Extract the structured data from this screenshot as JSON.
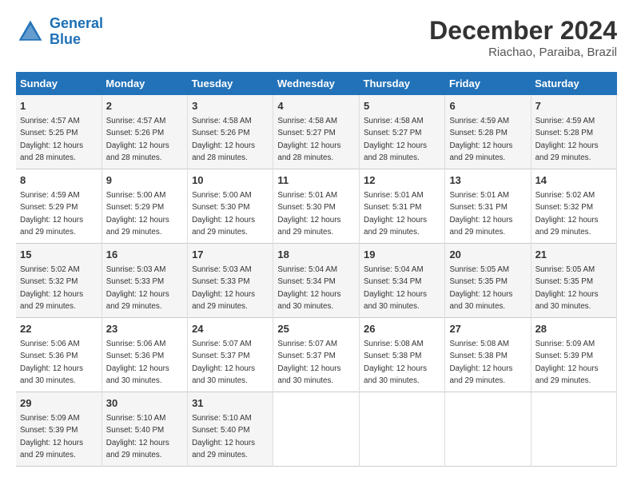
{
  "header": {
    "logo_line1": "General",
    "logo_line2": "Blue",
    "month_year": "December 2024",
    "location": "Riachao, Paraiba, Brazil"
  },
  "weekdays": [
    "Sunday",
    "Monday",
    "Tuesday",
    "Wednesday",
    "Thursday",
    "Friday",
    "Saturday"
  ],
  "weeks": [
    [
      {
        "day": "1",
        "sunrise": "4:57 AM",
        "sunset": "5:25 PM",
        "daylight": "12 hours and 28 minutes."
      },
      {
        "day": "2",
        "sunrise": "4:57 AM",
        "sunset": "5:26 PM",
        "daylight": "12 hours and 28 minutes."
      },
      {
        "day": "3",
        "sunrise": "4:58 AM",
        "sunset": "5:26 PM",
        "daylight": "12 hours and 28 minutes."
      },
      {
        "day": "4",
        "sunrise": "4:58 AM",
        "sunset": "5:27 PM",
        "daylight": "12 hours and 28 minutes."
      },
      {
        "day": "5",
        "sunrise": "4:58 AM",
        "sunset": "5:27 PM",
        "daylight": "12 hours and 28 minutes."
      },
      {
        "day": "6",
        "sunrise": "4:59 AM",
        "sunset": "5:28 PM",
        "daylight": "12 hours and 29 minutes."
      },
      {
        "day": "7",
        "sunrise": "4:59 AM",
        "sunset": "5:28 PM",
        "daylight": "12 hours and 29 minutes."
      }
    ],
    [
      {
        "day": "8",
        "sunrise": "4:59 AM",
        "sunset": "5:29 PM",
        "daylight": "12 hours and 29 minutes."
      },
      {
        "day": "9",
        "sunrise": "5:00 AM",
        "sunset": "5:29 PM",
        "daylight": "12 hours and 29 minutes."
      },
      {
        "day": "10",
        "sunrise": "5:00 AM",
        "sunset": "5:30 PM",
        "daylight": "12 hours and 29 minutes."
      },
      {
        "day": "11",
        "sunrise": "5:01 AM",
        "sunset": "5:30 PM",
        "daylight": "12 hours and 29 minutes."
      },
      {
        "day": "12",
        "sunrise": "5:01 AM",
        "sunset": "5:31 PM",
        "daylight": "12 hours and 29 minutes."
      },
      {
        "day": "13",
        "sunrise": "5:01 AM",
        "sunset": "5:31 PM",
        "daylight": "12 hours and 29 minutes."
      },
      {
        "day": "14",
        "sunrise": "5:02 AM",
        "sunset": "5:32 PM",
        "daylight": "12 hours and 29 minutes."
      }
    ],
    [
      {
        "day": "15",
        "sunrise": "5:02 AM",
        "sunset": "5:32 PM",
        "daylight": "12 hours and 29 minutes."
      },
      {
        "day": "16",
        "sunrise": "5:03 AM",
        "sunset": "5:33 PM",
        "daylight": "12 hours and 29 minutes."
      },
      {
        "day": "17",
        "sunrise": "5:03 AM",
        "sunset": "5:33 PM",
        "daylight": "12 hours and 29 minutes."
      },
      {
        "day": "18",
        "sunrise": "5:04 AM",
        "sunset": "5:34 PM",
        "daylight": "12 hours and 30 minutes."
      },
      {
        "day": "19",
        "sunrise": "5:04 AM",
        "sunset": "5:34 PM",
        "daylight": "12 hours and 30 minutes."
      },
      {
        "day": "20",
        "sunrise": "5:05 AM",
        "sunset": "5:35 PM",
        "daylight": "12 hours and 30 minutes."
      },
      {
        "day": "21",
        "sunrise": "5:05 AM",
        "sunset": "5:35 PM",
        "daylight": "12 hours and 30 minutes."
      }
    ],
    [
      {
        "day": "22",
        "sunrise": "5:06 AM",
        "sunset": "5:36 PM",
        "daylight": "12 hours and 30 minutes."
      },
      {
        "day": "23",
        "sunrise": "5:06 AM",
        "sunset": "5:36 PM",
        "daylight": "12 hours and 30 minutes."
      },
      {
        "day": "24",
        "sunrise": "5:07 AM",
        "sunset": "5:37 PM",
        "daylight": "12 hours and 30 minutes."
      },
      {
        "day": "25",
        "sunrise": "5:07 AM",
        "sunset": "5:37 PM",
        "daylight": "12 hours and 30 minutes."
      },
      {
        "day": "26",
        "sunrise": "5:08 AM",
        "sunset": "5:38 PM",
        "daylight": "12 hours and 30 minutes."
      },
      {
        "day": "27",
        "sunrise": "5:08 AM",
        "sunset": "5:38 PM",
        "daylight": "12 hours and 29 minutes."
      },
      {
        "day": "28",
        "sunrise": "5:09 AM",
        "sunset": "5:39 PM",
        "daylight": "12 hours and 29 minutes."
      }
    ],
    [
      {
        "day": "29",
        "sunrise": "5:09 AM",
        "sunset": "5:39 PM",
        "daylight": "12 hours and 29 minutes."
      },
      {
        "day": "30",
        "sunrise": "5:10 AM",
        "sunset": "5:40 PM",
        "daylight": "12 hours and 29 minutes."
      },
      {
        "day": "31",
        "sunrise": "5:10 AM",
        "sunset": "5:40 PM",
        "daylight": "12 hours and 29 minutes."
      },
      null,
      null,
      null,
      null
    ]
  ]
}
